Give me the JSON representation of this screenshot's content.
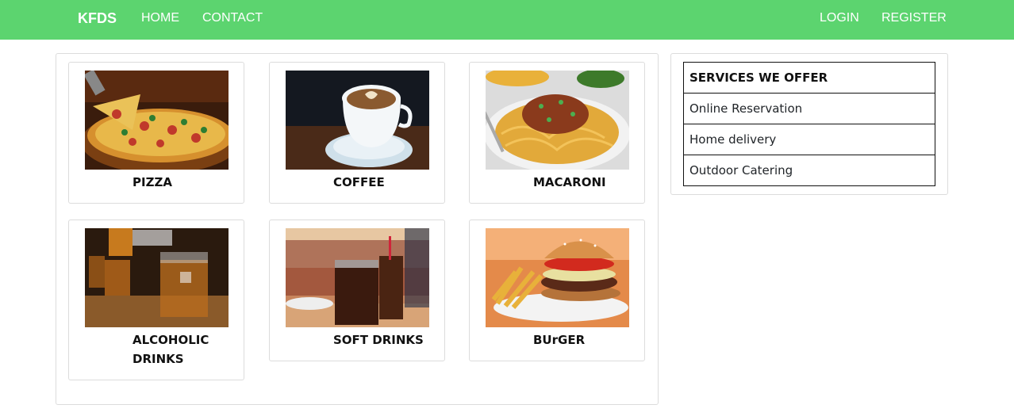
{
  "nav": {
    "brand": "KFDS",
    "home": "HOME",
    "contact": "CONTACT",
    "login": "LOGIN",
    "register": "REGISTER"
  },
  "colors": {
    "navbar": "#5cd46f",
    "nav_text": "#ffffff",
    "border": "#dcdcdc"
  },
  "menu": {
    "items": [
      {
        "label": "PIZZA",
        "image": "pizza-photo"
      },
      {
        "label": "COFFEE",
        "image": "coffee-photo"
      },
      {
        "label": "MACARONI",
        "image": "macaroni-photo"
      },
      {
        "label_line1": "ALCOHOLIC",
        "label_line2": "DRINKS",
        "image": "alcoholic-drinks-photo"
      },
      {
        "label": "SOFT DRINKS",
        "image": "soft-drinks-photo"
      },
      {
        "label": "BUrGER",
        "image": "burger-photo"
      }
    ]
  },
  "services": {
    "title": "SERVICES WE OFFER",
    "items": [
      "Online Reservation",
      "Home delivery",
      "Outdoor Catering"
    ]
  }
}
